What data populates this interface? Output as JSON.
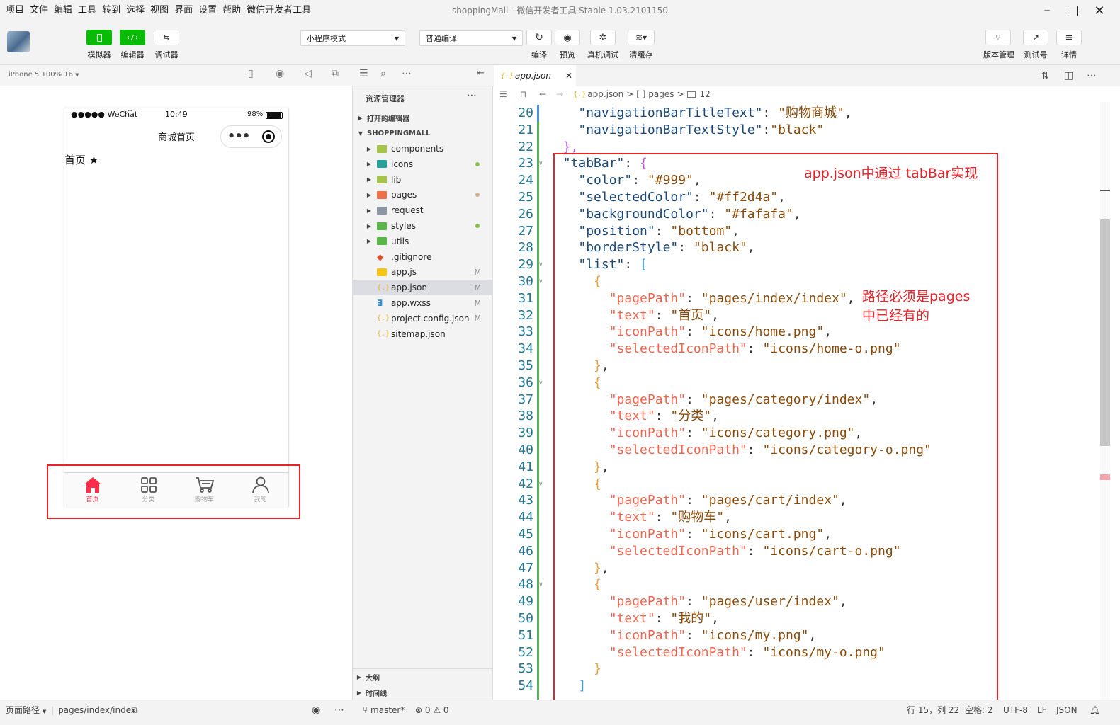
{
  "menubar": {
    "items": [
      "项目",
      "文件",
      "编辑",
      "工具",
      "转到",
      "选择",
      "视图",
      "界面",
      "设置",
      "帮助",
      "微信开发者工具"
    ],
    "title": "shoppingMall - 微信开发者工具 Stable 1.03.2101150"
  },
  "toolbar": {
    "simulator": "模拟器",
    "editor": "编辑器",
    "debugger": "调试器",
    "mode_select": "小程序模式",
    "compile_select": "普通编译",
    "compile": "编译",
    "preview": "预览",
    "real_debug": "真机调试",
    "clear_cache": "清缓存",
    "version": "版本管理",
    "test_id": "测试号",
    "details": "详情"
  },
  "simulator": {
    "device": "iPhone 5 100% 16",
    "carrier": "●●●●● WeChat",
    "time": "10:49",
    "battery": "98%",
    "nav_title": "商城首页",
    "page_text": "首页",
    "tabs": [
      {
        "text": "首页",
        "icon": "home-icon",
        "selected": true
      },
      {
        "text": "分类",
        "icon": "category-icon",
        "selected": false
      },
      {
        "text": "购物车",
        "icon": "cart-icon",
        "selected": false
      },
      {
        "text": "我的",
        "icon": "user-icon",
        "selected": false
      }
    ],
    "colors": {
      "selected": "#ff2d4a",
      "normal": "#999999"
    }
  },
  "explorer": {
    "title": "资源管理器",
    "open_editors": "打开的编辑器",
    "project": "SHOPPINGMALL",
    "items": [
      {
        "name": "components",
        "type": "folder"
      },
      {
        "name": "icons",
        "type": "folder"
      },
      {
        "name": "lib",
        "type": "folder"
      },
      {
        "name": "pages",
        "type": "folder"
      },
      {
        "name": "request",
        "type": "folder"
      },
      {
        "name": "styles",
        "type": "folder"
      },
      {
        "name": "utils",
        "type": "folder"
      },
      {
        "name": ".gitignore",
        "type": "git"
      },
      {
        "name": "app.js",
        "type": "js",
        "mark": "M"
      },
      {
        "name": "app.json",
        "type": "json",
        "mark": "M",
        "selected": true
      },
      {
        "name": "app.wxss",
        "type": "css",
        "mark": "M"
      },
      {
        "name": "project.config.json",
        "type": "json",
        "mark": "M"
      },
      {
        "name": "sitemap.json",
        "type": "json"
      }
    ],
    "outline": "大纲",
    "timeline": "时间线"
  },
  "editor": {
    "tab": "app.json",
    "breadcrumb": {
      "file": "app.json",
      "node": "[ ] pages",
      "count": "12"
    },
    "lines": [
      {
        "n": "20",
        "parts": [
          [
            "    ",
            "p"
          ],
          [
            "\"navigationBarTitleText\"",
            "k"
          ],
          [
            ": ",
            "p"
          ],
          [
            "\"购物商城\"",
            "s"
          ],
          [
            ",",
            "p"
          ]
        ]
      },
      {
        "n": "21",
        "parts": [
          [
            "    ",
            "p"
          ],
          [
            "\"navigationBarTextStyle\"",
            "k"
          ],
          [
            ":",
            "p"
          ],
          [
            "\"black\"",
            "s"
          ]
        ]
      },
      {
        "n": "22",
        "parts": [
          [
            "  ",
            "p"
          ],
          [
            "},",
            "b2"
          ]
        ]
      },
      {
        "n": "23",
        "fold": true,
        "parts": [
          [
            "  ",
            "p"
          ],
          [
            "\"tabBar\"",
            "k"
          ],
          [
            ": ",
            "p"
          ],
          [
            "{",
            "b2"
          ]
        ]
      },
      {
        "n": "24",
        "parts": [
          [
            "    ",
            "p"
          ],
          [
            "\"color\"",
            "k"
          ],
          [
            ": ",
            "p"
          ],
          [
            "\"#999\"",
            "s"
          ],
          [
            ",",
            "p"
          ]
        ]
      },
      {
        "n": "25",
        "parts": [
          [
            "    ",
            "p"
          ],
          [
            "\"selectedColor\"",
            "k"
          ],
          [
            ": ",
            "p"
          ],
          [
            "\"#ff2d4a\"",
            "s"
          ],
          [
            ",",
            "p"
          ]
        ]
      },
      {
        "n": "26",
        "parts": [
          [
            "    ",
            "p"
          ],
          [
            "\"backgroundColor\"",
            "k"
          ],
          [
            ": ",
            "p"
          ],
          [
            "\"#fafafa\"",
            "s"
          ],
          [
            ",",
            "p"
          ]
        ]
      },
      {
        "n": "27",
        "parts": [
          [
            "    ",
            "p"
          ],
          [
            "\"position\"",
            "k"
          ],
          [
            ": ",
            "p"
          ],
          [
            "\"bottom\"",
            "s"
          ],
          [
            ",",
            "p"
          ]
        ]
      },
      {
        "n": "28",
        "parts": [
          [
            "    ",
            "p"
          ],
          [
            "\"borderStyle\"",
            "k"
          ],
          [
            ": ",
            "p"
          ],
          [
            "\"black\"",
            "s"
          ],
          [
            ",",
            "p"
          ]
        ]
      },
      {
        "n": "29",
        "fold": true,
        "parts": [
          [
            "    ",
            "p"
          ],
          [
            "\"list\"",
            "k"
          ],
          [
            ": ",
            "p"
          ],
          [
            "[",
            "b3"
          ]
        ]
      },
      {
        "n": "30",
        "fold": true,
        "parts": [
          [
            "      ",
            "p"
          ],
          [
            "{",
            "b1"
          ]
        ]
      },
      {
        "n": "31",
        "parts": [
          [
            "        ",
            "p"
          ],
          [
            "\"pagePath\"",
            "kp"
          ],
          [
            ": ",
            "p"
          ],
          [
            "\"pages/index/index\"",
            "s"
          ],
          [
            ",",
            "p"
          ]
        ]
      },
      {
        "n": "32",
        "parts": [
          [
            "        ",
            "p"
          ],
          [
            "\"text\"",
            "kp"
          ],
          [
            ": ",
            "p"
          ],
          [
            "\"首页\"",
            "s"
          ],
          [
            ",",
            "p"
          ]
        ]
      },
      {
        "n": "33",
        "parts": [
          [
            "        ",
            "p"
          ],
          [
            "\"iconPath\"",
            "kp"
          ],
          [
            ": ",
            "p"
          ],
          [
            "\"icons/home.png\"",
            "s"
          ],
          [
            ",",
            "p"
          ]
        ]
      },
      {
        "n": "34",
        "parts": [
          [
            "        ",
            "p"
          ],
          [
            "\"selectedIconPath\"",
            "kp"
          ],
          [
            ": ",
            "p"
          ],
          [
            "\"icons/home-o.png\"",
            "s"
          ]
        ]
      },
      {
        "n": "35",
        "parts": [
          [
            "      ",
            "p"
          ],
          [
            "}",
            "b1"
          ],
          [
            ",",
            "p"
          ]
        ]
      },
      {
        "n": "36",
        "fold": true,
        "parts": [
          [
            "      ",
            "p"
          ],
          [
            "{",
            "b1"
          ]
        ]
      },
      {
        "n": "37",
        "parts": [
          [
            "        ",
            "p"
          ],
          [
            "\"pagePath\"",
            "kp"
          ],
          [
            ": ",
            "p"
          ],
          [
            "\"pages/category/index\"",
            "s"
          ],
          [
            ",",
            "p"
          ]
        ]
      },
      {
        "n": "38",
        "parts": [
          [
            "        ",
            "p"
          ],
          [
            "\"text\"",
            "kp"
          ],
          [
            ": ",
            "p"
          ],
          [
            "\"分类\"",
            "s"
          ],
          [
            ",",
            "p"
          ]
        ]
      },
      {
        "n": "39",
        "parts": [
          [
            "        ",
            "p"
          ],
          [
            "\"iconPath\"",
            "kp"
          ],
          [
            ": ",
            "p"
          ],
          [
            "\"icons/category.png\"",
            "s"
          ],
          [
            ",",
            "p"
          ]
        ]
      },
      {
        "n": "40",
        "parts": [
          [
            "        ",
            "p"
          ],
          [
            "\"selectedIconPath\"",
            "kp"
          ],
          [
            ": ",
            "p"
          ],
          [
            "\"icons/category-o.png\"",
            "s"
          ]
        ]
      },
      {
        "n": "41",
        "parts": [
          [
            "      ",
            "p"
          ],
          [
            "}",
            "b1"
          ],
          [
            ",",
            "p"
          ]
        ]
      },
      {
        "n": "42",
        "fold": true,
        "parts": [
          [
            "      ",
            "p"
          ],
          [
            "{",
            "b1"
          ]
        ]
      },
      {
        "n": "43",
        "parts": [
          [
            "        ",
            "p"
          ],
          [
            "\"pagePath\"",
            "kp"
          ],
          [
            ": ",
            "p"
          ],
          [
            "\"pages/cart/index\"",
            "s"
          ],
          [
            ",",
            "p"
          ]
        ]
      },
      {
        "n": "44",
        "parts": [
          [
            "        ",
            "p"
          ],
          [
            "\"text\"",
            "kp"
          ],
          [
            ": ",
            "p"
          ],
          [
            "\"购物车\"",
            "s"
          ],
          [
            ",",
            "p"
          ]
        ]
      },
      {
        "n": "45",
        "parts": [
          [
            "        ",
            "p"
          ],
          [
            "\"iconPath\"",
            "kp"
          ],
          [
            ": ",
            "p"
          ],
          [
            "\"icons/cart.png\"",
            "s"
          ],
          [
            ",",
            "p"
          ]
        ]
      },
      {
        "n": "46",
        "parts": [
          [
            "        ",
            "p"
          ],
          [
            "\"selectedIconPath\"",
            "kp"
          ],
          [
            ": ",
            "p"
          ],
          [
            "\"icons/cart-o.png\"",
            "s"
          ]
        ]
      },
      {
        "n": "47",
        "parts": [
          [
            "      ",
            "p"
          ],
          [
            "}",
            "b1"
          ],
          [
            ",",
            "p"
          ]
        ]
      },
      {
        "n": "48",
        "fold": true,
        "parts": [
          [
            "      ",
            "p"
          ],
          [
            "{",
            "b1"
          ]
        ]
      },
      {
        "n": "49",
        "parts": [
          [
            "        ",
            "p"
          ],
          [
            "\"pagePath\"",
            "kp"
          ],
          [
            ": ",
            "p"
          ],
          [
            "\"pages/user/index\"",
            "s"
          ],
          [
            ",",
            "p"
          ]
        ]
      },
      {
        "n": "50",
        "parts": [
          [
            "        ",
            "p"
          ],
          [
            "\"text\"",
            "kp"
          ],
          [
            ": ",
            "p"
          ],
          [
            "\"我的\"",
            "s"
          ],
          [
            ",",
            "p"
          ]
        ]
      },
      {
        "n": "51",
        "parts": [
          [
            "        ",
            "p"
          ],
          [
            "\"iconPath\"",
            "kp"
          ],
          [
            ": ",
            "p"
          ],
          [
            "\"icons/my.png\"",
            "s"
          ],
          [
            ",",
            "p"
          ]
        ]
      },
      {
        "n": "52",
        "parts": [
          [
            "        ",
            "p"
          ],
          [
            "\"selectedIconPath\"",
            "kp"
          ],
          [
            ": ",
            "p"
          ],
          [
            "\"icons/my-o.png\"",
            "s"
          ]
        ]
      },
      {
        "n": "53",
        "parts": [
          [
            "      ",
            "p"
          ],
          [
            "}",
            "b1"
          ]
        ]
      },
      {
        "n": "54",
        "parts": [
          [
            "    ",
            "p"
          ],
          [
            "]",
            "b3"
          ]
        ]
      }
    ],
    "annotations": {
      "tabbar_note": "app.json中通过 tabBar实现",
      "path_note_1": "路径必须是pages",
      "path_note_2": "中已经有的"
    }
  },
  "statusbar": {
    "page_path_label": "页面路径",
    "page_path": "pages/index/index",
    "branch": "master*",
    "problems": "⊗ 0 ⚠ 0",
    "cursor": "行 15，列 22",
    "indent": "空格: 2",
    "encoding": "UTF-8",
    "eol": "LF",
    "language": "JSON"
  }
}
